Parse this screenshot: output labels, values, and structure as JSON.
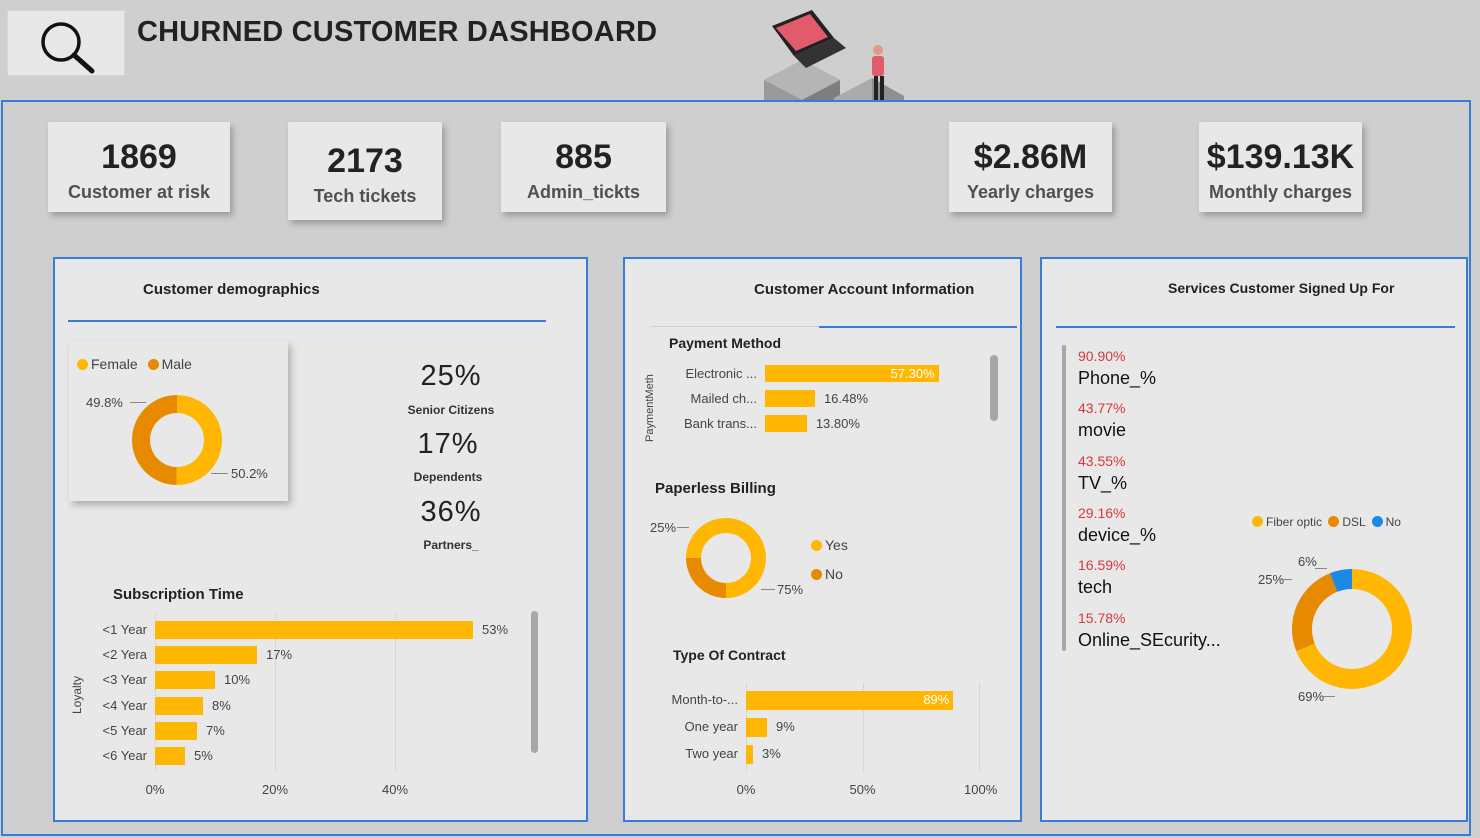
{
  "header": {
    "title": "CHURNED CUSTOMER DASHBOARD",
    "logo_icon": "magnifier-icon"
  },
  "kpis": [
    {
      "value": "1869",
      "label": "Customer at risk"
    },
    {
      "value": "2173",
      "label": "Tech tickets"
    },
    {
      "value": "885",
      "label": "Admin_tickts"
    },
    {
      "value": "$2.86M",
      "label": "Yearly charges"
    },
    {
      "value": "$139.13K",
      "label": "Monthly charges"
    }
  ],
  "demographics": {
    "title": "Customer demographics",
    "gender_legend": [
      "Female",
      "Male"
    ],
    "gender_labels": {
      "male": "49.8%",
      "female": "50.2%"
    },
    "stats": [
      {
        "value": "25%",
        "label": "Senior Citizens"
      },
      {
        "value": "17%",
        "label": "Dependents"
      },
      {
        "value": "36%",
        "label": "Partners_"
      }
    ]
  },
  "subscription": {
    "title": "Subscription Time",
    "axis_label": "Loyalty",
    "ticks": [
      "0%",
      "20%",
      "40%"
    ]
  },
  "account": {
    "title": "Customer Account Information",
    "payment_title": "Payment Method",
    "payment_axis_label": "PaymentMeth",
    "paperless_title": "Paperless Billing",
    "paperless_legend": [
      "Yes",
      "No"
    ],
    "paperless_labels": {
      "no": "25%",
      "yes": "75%"
    },
    "contract_title": "Type Of Contract",
    "contract_ticks": [
      "0%",
      "50%",
      "100%"
    ]
  },
  "services": {
    "title": "Services Customer Signed Up  For",
    "items": [
      {
        "pct": "90.90%",
        "label": "Phone_%"
      },
      {
        "pct": "43.77%",
        "label": "movie"
      },
      {
        "pct": "43.55%",
        "label": "TV_%"
      },
      {
        "pct": "29.16%",
        "label": "device_%"
      },
      {
        "pct": "16.59%",
        "label": "tech"
      },
      {
        "pct": "15.78%",
        "label": "Online_SEcurity..."
      }
    ],
    "internet_legend": [
      "Fiber optic",
      "DSL",
      "No"
    ],
    "internet_labels": {
      "no": "6%",
      "dsl": "25%",
      "fiber": "69%"
    }
  },
  "colors": {
    "accent": "#3a7bd5",
    "gold": "#ffb703",
    "orange": "#e88a00",
    "blue": "#1e88e5",
    "pct_red": "#d8373c"
  },
  "chart_data": [
    {
      "type": "pie",
      "title": "",
      "categories": [
        "Female",
        "Male"
      ],
      "values": [
        50.2,
        49.8
      ]
    },
    {
      "type": "bar",
      "title": "Subscription Time",
      "ylabel": "Loyalty",
      "categories": [
        "<1 Year",
        "<2 Yera",
        "<3 Year",
        "<4 Year",
        "<5 Year",
        "<6 Year"
      ],
      "values": [
        53,
        17,
        10,
        8,
        7,
        5
      ],
      "value_labels": [
        "53%",
        "17%",
        "10%",
        "8%",
        "7%",
        "5%"
      ],
      "xlim": [
        0,
        60
      ]
    },
    {
      "type": "bar",
      "title": "Payment Method",
      "ylabel": "PaymentMeth",
      "categories": [
        "Electronic ...",
        "Mailed ch...",
        "Bank trans..."
      ],
      "values": [
        57.3,
        16.48,
        13.8
      ],
      "value_labels": [
        "57.30%",
        "16.48%",
        "13.80%"
      ],
      "xlim": [
        0,
        65
      ]
    },
    {
      "type": "pie",
      "title": "Paperless Billing",
      "categories": [
        "Yes",
        "No"
      ],
      "values": [
        75,
        25
      ]
    },
    {
      "type": "bar",
      "title": "Type Of Contract",
      "categories": [
        "Month-to-...",
        "One year",
        "Two year"
      ],
      "values": [
        89,
        9,
        3
      ],
      "value_labels": [
        "89%",
        "9%",
        "3%"
      ],
      "xlim": [
        0,
        100
      ]
    },
    {
      "type": "pie",
      "title": "",
      "categories": [
        "Fiber optic",
        "DSL",
        "No"
      ],
      "values": [
        69,
        25,
        6
      ]
    }
  ]
}
